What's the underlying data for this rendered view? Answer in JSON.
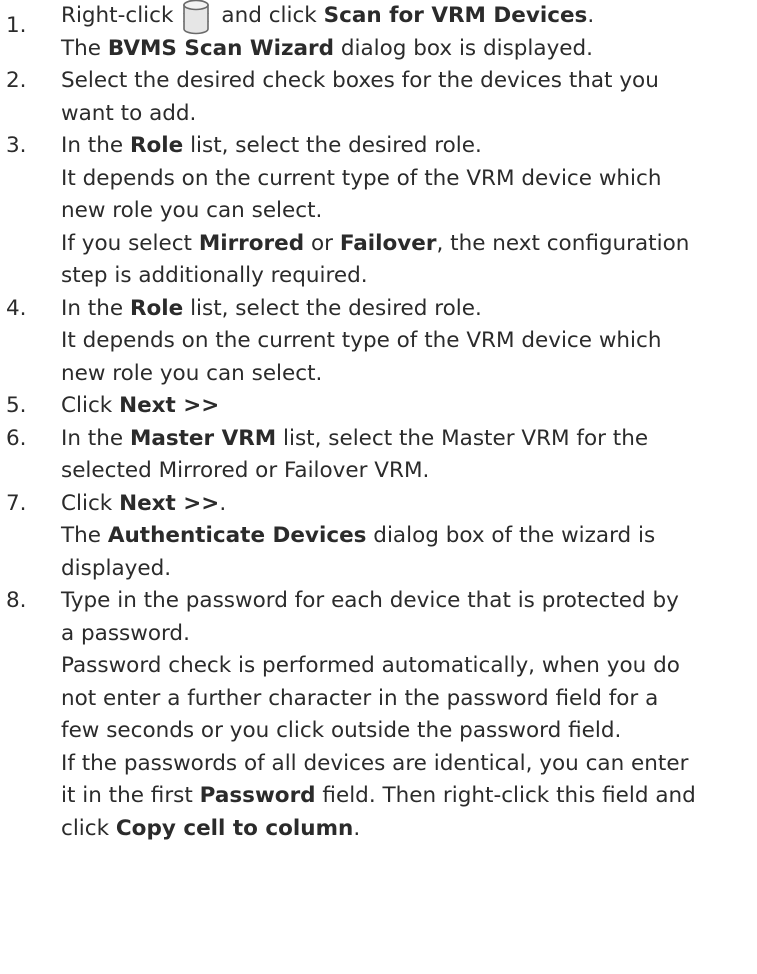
{
  "steps": [
    {
      "num": "1.",
      "lines": [
        {
          "pre": "Right-click",
          "bold": "Scan for VRM Devices",
          "post": ".",
          "mid": "and click",
          "icon": "database-icon"
        },
        {
          "pre": "The",
          "bold": "BVMS Scan Wizard",
          "post": "dialog box is displayed."
        }
      ]
    },
    {
      "num": "2.",
      "lines": [
        "Select the desired check boxes for the devices that you",
        "want to add."
      ]
    },
    {
      "num": "3.",
      "lines": [
        {
          "pre": "In the",
          "bold": "Role",
          "post": "list, select the desired role."
        },
        "It depends on the current type of the VRM device which",
        "new role you can select.",
        {
          "pre": "If you select",
          "bold": "Mirrored",
          "mid": "or",
          "bold2": "Failover",
          "post": ", the next configuration"
        },
        "step is additionally required."
      ]
    },
    {
      "num": "4.",
      "lines": [
        {
          "pre": "In the",
          "bold": "Role",
          "post": "list, select the desired role."
        },
        "It depends on the current type of the VRM device which",
        "new role you can select."
      ]
    },
    {
      "num": "5.",
      "lines": [
        {
          "pre": "Click",
          "bold": "Next >>"
        }
      ]
    },
    {
      "num": "6.",
      "lines": [
        {
          "pre": "In the",
          "bold": "Master VRM",
          "post": "list, select the Master VRM for the"
        },
        "selected Mirrored or Failover VRM."
      ]
    },
    {
      "num": "7.",
      "lines": [
        {
          "pre": "Click",
          "bold": "Next >>",
          "post": "."
        },
        {
          "pre": "The",
          "bold": "Authenticate Devices",
          "post": "dialog box of the wizard is"
        },
        "displayed."
      ]
    },
    {
      "num": "8.",
      "lines": [
        "Type in the password for each device that is protected by",
        "a password.",
        "Password check is performed automatically, when you do",
        "not enter a further character in the password field for a",
        "few seconds or you click outside the password field.",
        "If the passwords of all devices are identical, you can enter",
        {
          "pre": "it in the first",
          "bold": "Password",
          "post": "field. Then right-click this field and"
        },
        {
          "pre": "click",
          "bold": "Copy cell to column",
          "post": "."
        }
      ]
    }
  ]
}
